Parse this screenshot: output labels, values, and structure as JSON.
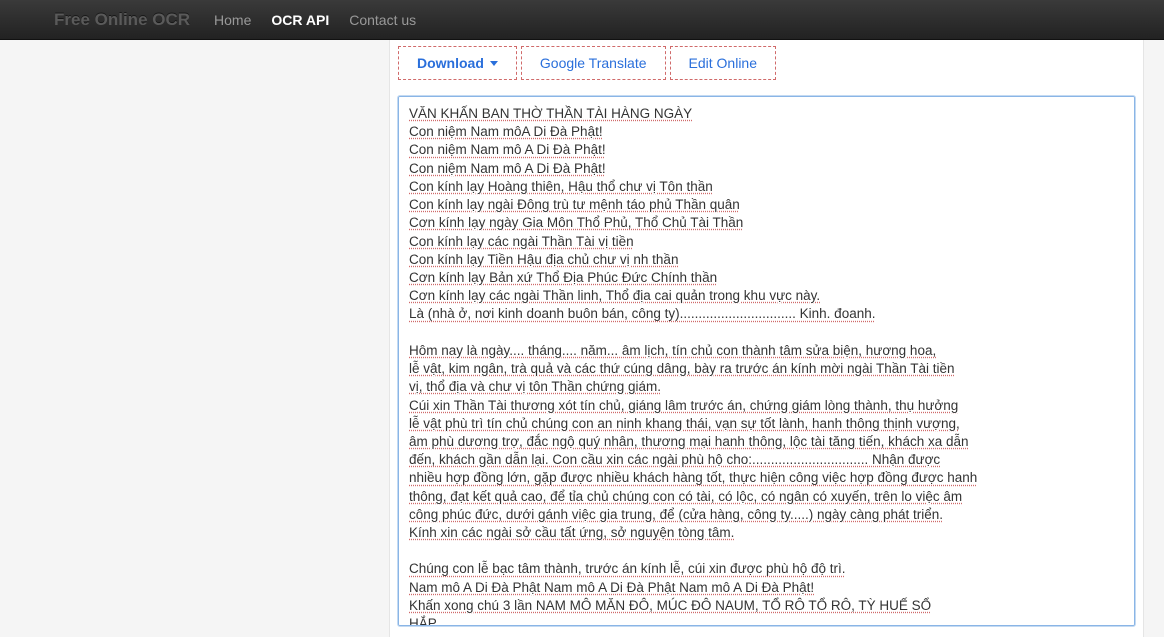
{
  "navbar": {
    "brand": "Free Online OCR",
    "links": {
      "home": "Home",
      "api": "OCR API",
      "contact": "Contact us"
    }
  },
  "toolbar": {
    "download": "Download",
    "translate": "Google Translate",
    "edit": "Edit Online"
  },
  "ocr_text": "VĂN KHẤN BAN THỜ THẦN TÀI HÀNG NGÀY\nCon niệm Nam môA Di Đà Phật!\nCon niệm Nam mô A Di Đà Phật!\nCon niệm Nam mô A Di Đà Phật!\nCon kính lạy Hoàng thiên, Hậu thổ chư vị Tôn thần\nCon kính lạy ngài Đông trù tư mệnh táo phủ Thần quân\nCơn kính lạy ngày Gia Môn Thổ Phủ, Thổ Chủ Tài Thần\nCon kính lạy các ngài Thần Tài vị tiền\nCon kính lạy Tiền Hậu địa chủ chư vị nh thần\nCơn kính lạy Bản xứ Thổ Địa Phúc Đức Chính thần\nCơn kính lạy các ngài Thần linh, Thổ địa cai quản trong khu vực này.\nLà (nhà ở, nơi kinh doanh buôn bán, công ty)............................... Kinh. đoanh.\n\nHôm nay là ngày.... tháng.... năm... âm lịch, tín chủ con thành tâm sửa biện, hương hoa,\nlễ vật, kim ngân, trà quả và các thứ cúng dâng, bày ra trước án kính mời ngài Thần Tài tiền\nvị, thổ địa và chư vị tôn Thần chứng giám.\nCúi xin Thần Tài thương xót tín chủ, giáng lâm trước án, chứng giám lòng thành, thụ hưởng\nlễ vật phù trì tín chủ chúng con an ninh khang thái, vạn sự tốt lành, hanh thông thịnh vượng,\nâm phù dương trợ, đắc ngộ quý nhân, thương mại hanh thông, lộc tài tăng tiến, khách xa dẫn\nđến, khách gần dẫn lại. Con cầu xin các ngài phù hộ cho:............................... Nhận được\nnhiều hợp đồng lớn, gặp được nhiều khách hàng tốt, thực hiện công việc hợp đồng được hanh\nthông, đạt kết quả cao, để tỉa chủ chúng con có tài, có lộc, có ngân có xuyến, trên lo việc âm\ncông phúc đức, dưới gánh việc gia trung, để (cửa hàng, công ty.....) ngày càng phát triển.\nKính xin các ngài sở cầu tất ứng, sở nguyện tòng tâm.\n\nChúng con lễ bạc tâm thành, trước án kính lễ, cúi xin được phù hộ độ trì.\nNam mô A Di Đà Phật Nam mô A Di Đà Phật Nam mô A Di Đà Phật!\nKhấn xong chú 3 lần NAM MÔ MĂN ĐÔ, MÚC ĐÔ NAUM, TỔ RÔ TỔ RÔ, TỲ HUẾ SỔ\nHẮP"
}
